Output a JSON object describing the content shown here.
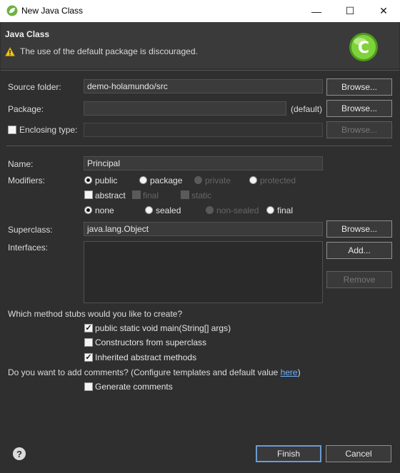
{
  "window": {
    "title": "New Java Class",
    "minimize": "—",
    "maximize": "☐",
    "close": "✕"
  },
  "header": {
    "title": "Java Class",
    "message": "The use of the default package is discouraged.",
    "warning_icon": "warning-icon",
    "wizard_icon": "new-class-icon",
    "wizard_icon_letter": "C"
  },
  "source_folder": {
    "label": "Source folder:",
    "value": "demo-holamundo/src",
    "browse": "Browse..."
  },
  "package": {
    "label": "Package:",
    "value": "",
    "default_text": "(default)",
    "browse": "Browse..."
  },
  "enclosing_type": {
    "label": "Enclosing type:",
    "value": "",
    "checked": false,
    "browse": "Browse..."
  },
  "name": {
    "label": "Name:",
    "value": "Principal"
  },
  "modifiers": {
    "label": "Modifiers:",
    "access": [
      "public",
      "package",
      "private",
      "protected"
    ],
    "access_selected": "public",
    "flags": [
      "abstract",
      "final",
      "static"
    ],
    "sealing": [
      "none",
      "sealed",
      "non-sealed",
      "final"
    ],
    "sealing_selected": "none"
  },
  "superclass": {
    "label": "Superclass:",
    "value": "java.lang.Object",
    "browse": "Browse..."
  },
  "interfaces": {
    "label": "Interfaces:",
    "add": "Add...",
    "remove": "Remove"
  },
  "stubs": {
    "question": "Which method stubs would you like to create?",
    "items": [
      {
        "label": "public static void main(String[] args)",
        "checked": true
      },
      {
        "label": "Constructors from superclass",
        "checked": false
      },
      {
        "label": "Inherited abstract methods",
        "checked": true
      }
    ]
  },
  "comments": {
    "question": "Do you want to add comments? (Configure templates and default value ",
    "link": "here",
    "question_end": ")",
    "generate": "Generate comments",
    "checked": false
  },
  "footer": {
    "help": "?",
    "finish": "Finish",
    "cancel": "Cancel"
  },
  "colors": {
    "background": "#2f2f2f",
    "link": "#6fb0ff",
    "wizard_icon": "#56c128"
  }
}
